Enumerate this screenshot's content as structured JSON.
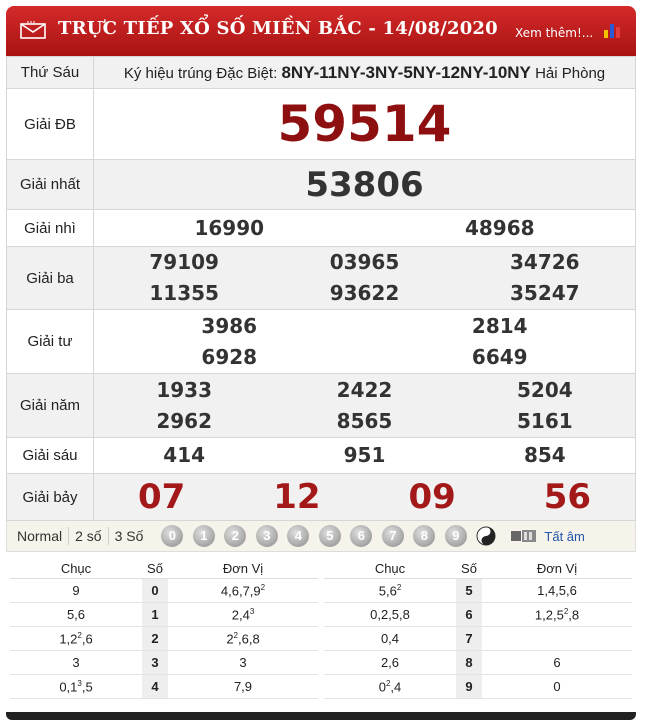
{
  "header": {
    "title": "TRỰC TIẾP XỔ SỐ MIỀN BẮC - 14/08/2020",
    "more_link": "Xem thêm!...",
    "accent": "#b81c1c"
  },
  "info": {
    "day": "Thứ Sáu",
    "special_code_label": "Ký hiệu trúng Đặc Biệt:",
    "special_codes": "8NY-11NY-3NY-5NY-12NY-10NY",
    "province": "Hải Phòng"
  },
  "prizes": {
    "db": {
      "label": "Giải ĐB",
      "values": [
        "59514"
      ]
    },
    "nhat": {
      "label": "Giải nhất",
      "values": [
        "53806"
      ]
    },
    "nhi": {
      "label": "Giải nhì",
      "values": [
        "16990",
        "48968"
      ]
    },
    "ba": {
      "label": "Giải ba",
      "values": [
        "79109",
        "03965",
        "34726",
        "11355",
        "93622",
        "35247"
      ]
    },
    "tu": {
      "label": "Giải tư",
      "values": [
        "3986",
        "2814",
        "6928",
        "6649"
      ]
    },
    "nam": {
      "label": "Giải năm",
      "values": [
        "1933",
        "2422",
        "5204",
        "2962",
        "8565",
        "5161"
      ]
    },
    "sau": {
      "label": "Giải sáu",
      "values": [
        "414",
        "951",
        "854"
      ]
    },
    "bay": {
      "label": "Giải bảy",
      "values": [
        "07",
        "12",
        "09",
        "56"
      ]
    }
  },
  "filter": {
    "options": [
      "Normal",
      "2 số",
      "3 Số"
    ],
    "digits": [
      "0",
      "1",
      "2",
      "3",
      "4",
      "5",
      "6",
      "7",
      "8",
      "9"
    ],
    "tat_am": "Tất âm"
  },
  "loto": {
    "headers": [
      "Chục",
      "Số",
      "Đơn Vị"
    ],
    "left": [
      {
        "chuc": "9",
        "so": "0",
        "dv": "4,6,7,9",
        "dv_sup": "2",
        "chuc_sup": ""
      },
      {
        "chuc": "5,6",
        "so": "1",
        "dv": "2,4",
        "dv_sup": "3",
        "chuc_sup": ""
      },
      {
        "chuc": "1,2",
        "chuc_sup": "2",
        "chuc_tail": ",6",
        "so": "2",
        "dv": "2",
        "dv_sup": "2",
        "dv_tail": ",6,8"
      },
      {
        "chuc": "3",
        "so": "3",
        "dv": "3",
        "dv_sup": "",
        "chuc_sup": ""
      },
      {
        "chuc": "0,1",
        "chuc_sup": "3",
        "chuc_tail": ",5",
        "so": "4",
        "dv": "7,9",
        "dv_sup": ""
      }
    ],
    "right": [
      {
        "chuc": "5,6",
        "chuc_sup": "2",
        "so": "5",
        "dv": "1,4,5,6",
        "dv_sup": ""
      },
      {
        "chuc": "0,2,5,8",
        "chuc_sup": "",
        "so": "6",
        "dv": "1,2,5",
        "dv_sup": "2",
        "dv_tail": ",8"
      },
      {
        "chuc": "0,4",
        "chuc_sup": "",
        "so": "7",
        "dv": "",
        "dv_sup": ""
      },
      {
        "chuc": "2,6",
        "chuc_sup": "",
        "so": "8",
        "dv": "6",
        "dv_sup": ""
      },
      {
        "chuc": "0",
        "chuc_sup": "2",
        "chuc_tail": ",4",
        "so": "9",
        "dv": "0",
        "dv_sup": ""
      }
    ]
  }
}
